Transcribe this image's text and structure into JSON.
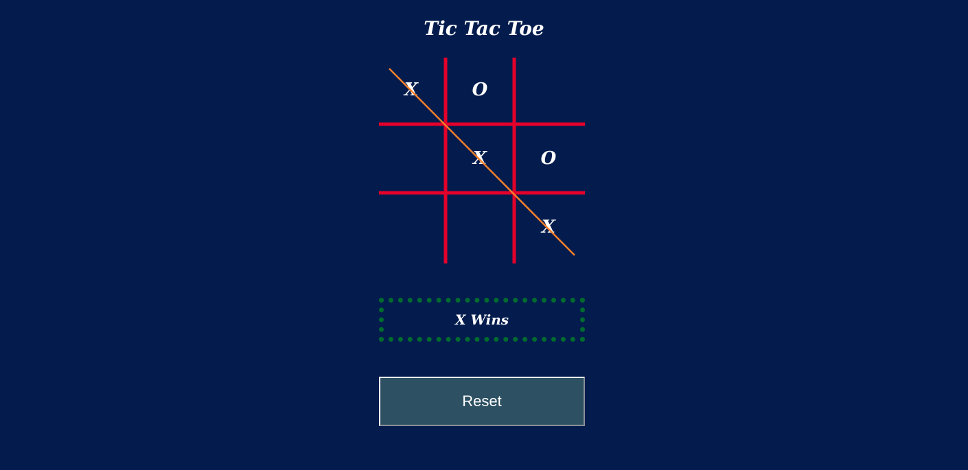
{
  "title": "Tic Tac Toe",
  "board": {
    "cells": [
      "X",
      "O",
      "",
      "",
      "X",
      "O",
      "",
      "",
      "X"
    ]
  },
  "status": "X Wins",
  "reset_label": "Reset",
  "colors": {
    "background": "#041c4d",
    "grid": "#e4002b",
    "strike": "#f57f2a",
    "status_border": "#006b2e",
    "button": "#2d5063"
  }
}
